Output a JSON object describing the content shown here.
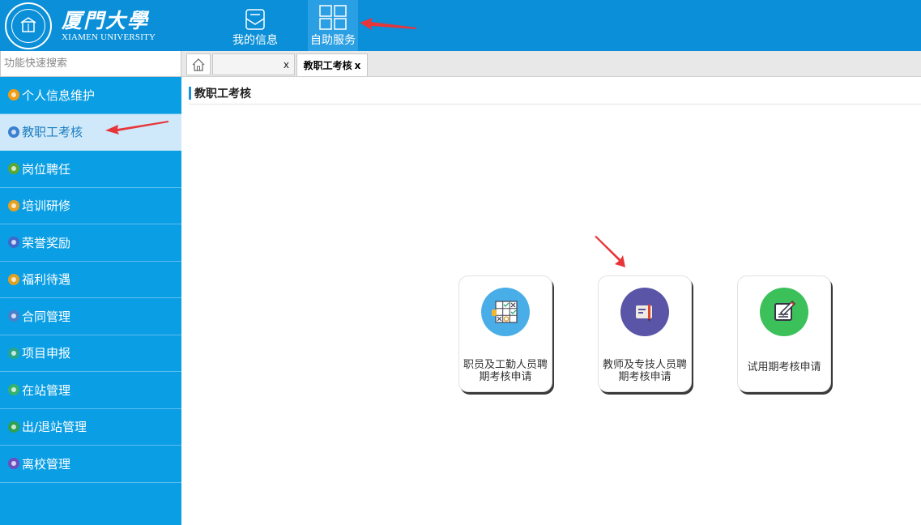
{
  "header": {
    "logo_cn": "厦門大學",
    "logo_en": "XIAMEN UNIVERSITY",
    "nav": [
      {
        "label": "我的信息",
        "icon": "envelope-icon"
      },
      {
        "label": "自助服务",
        "icon": "grid-icon"
      }
    ]
  },
  "search": {
    "placeholder": "功能快速搜索"
  },
  "tabs": {
    "home_icon": "home-icon",
    "blank_tab_close": "x",
    "active_tab_label": "教职工考核",
    "active_tab_close": "x"
  },
  "sidebar": {
    "items": [
      {
        "label": "个人信息维护",
        "color": "#f39c12"
      },
      {
        "label": "教职工考核",
        "color": "#3b7fd0",
        "active": true
      },
      {
        "label": "岗位聘任",
        "color": "#5aa832"
      },
      {
        "label": "培训研修",
        "color": "#e6a020"
      },
      {
        "label": "荣誉奖励",
        "color": "#3f69c9"
      },
      {
        "label": "福利待遇",
        "color": "#e0a020"
      },
      {
        "label": "合同管理",
        "color": "#4a7fc8"
      },
      {
        "label": "项目申报",
        "color": "#2aa58a"
      },
      {
        "label": "在站管理",
        "color": "#35b26b"
      },
      {
        "label": "出/退站管理",
        "color": "#2fa04e"
      },
      {
        "label": "离校管理",
        "color": "#6a4fbf"
      }
    ]
  },
  "main": {
    "title": "教职工考核",
    "cards": [
      {
        "label_line1": "职员及工勤人员聘",
        "label_line2": "期考核申请",
        "icon": "checklist-grid-icon",
        "color": "#49aee8"
      },
      {
        "label_line1": "教师及专技人员聘",
        "label_line2": "期考核申请",
        "icon": "document-pen-icon",
        "color": "#5b55a8"
      },
      {
        "label_line1": "试用期考核申请",
        "label_line2": "",
        "icon": "edit-note-icon",
        "color": "#3cc15a"
      }
    ]
  },
  "colors": {
    "header_bg": "#0a8fd8",
    "sidebar_bg": "#0a9ee4",
    "sidebar_active_bg": "#cfe9fa",
    "annotation_arrow": "#e8353a"
  }
}
